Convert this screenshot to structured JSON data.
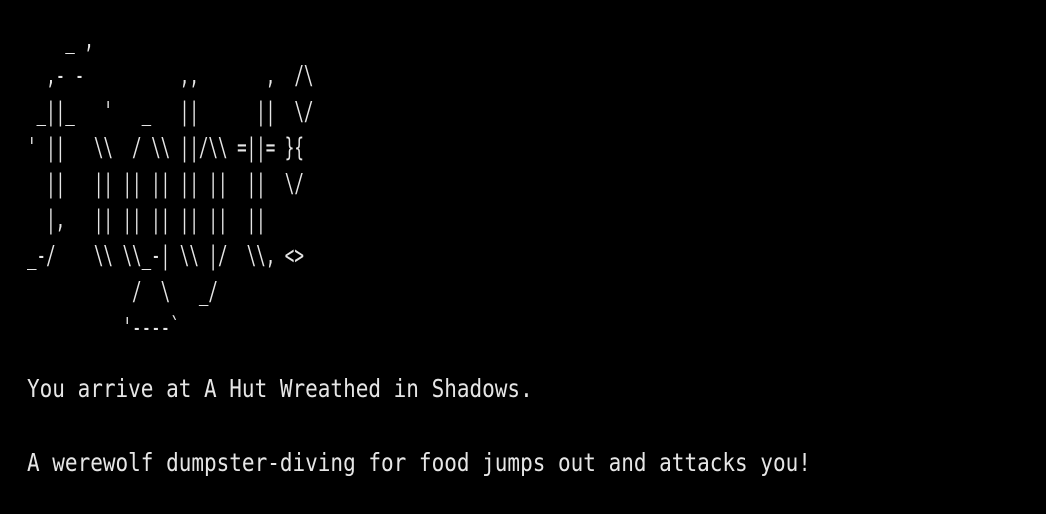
{
  "terminal": {
    "background_color": "#000000",
    "text_color": "#e6e6e6",
    "ascii_art": "    _ ,\n  ,- -          ,,       ,  /\\\n _||_   '   _   ||      ||  \\/\n' ||   \\\\  / \\\\ ||/\\\\ =||= }{\n  ||   || || || || ||  ||  \\/\n  |,   || || || || ||  ||\n_-/    \\\\ \\\\_-| \\\\ |/  \\\\, <>\n           /  \\   _/\n          '----`",
    "arrival_message": "You arrive at A Hut Wreathed in Shadows.",
    "encounter_message": "A werewolf dumpster-diving for food jumps out and attacks you!"
  }
}
